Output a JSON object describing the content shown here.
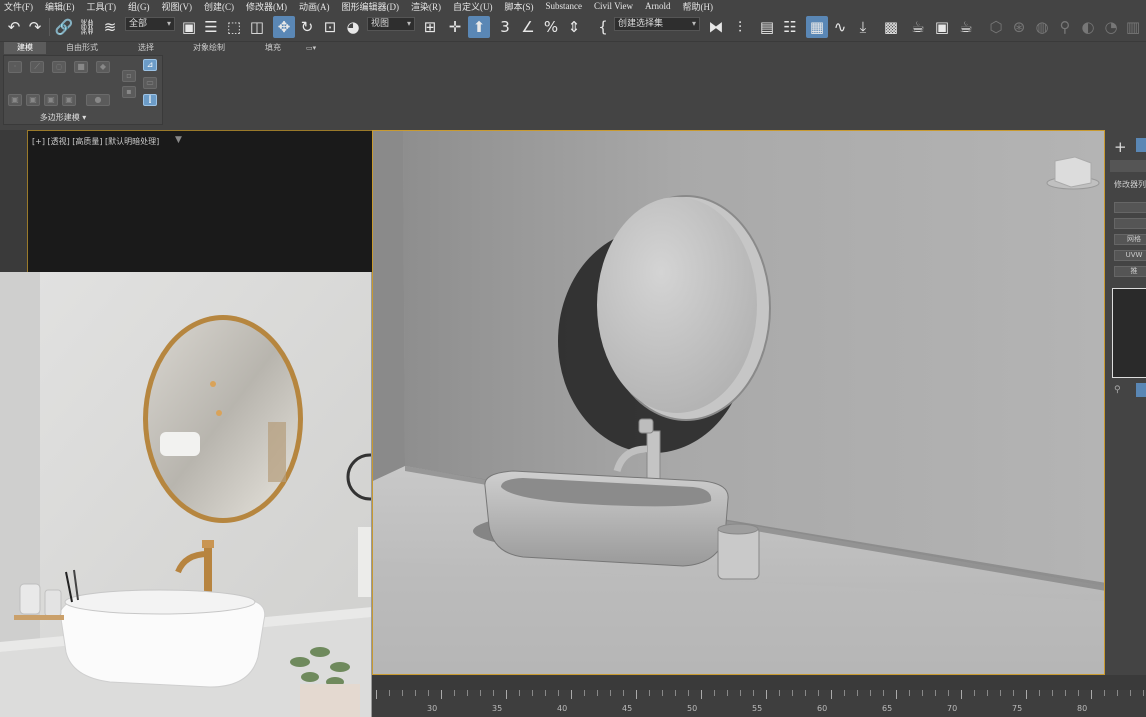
{
  "menu": [
    "文件(F)",
    "编辑(E)",
    "工具(T)",
    "组(G)",
    "视图(V)",
    "创建(C)",
    "修改器(M)",
    "动画(A)",
    "图形编辑器(D)",
    "渲染(R)",
    "自定义(U)",
    "脚本(S)",
    "Substance",
    "Civil View",
    "Arnold",
    "帮助(H)"
  ],
  "toolbar": {
    "filter_value": "全部",
    "refcoord_value": "视图",
    "selection_set_placeholder": "创建选择集"
  },
  "ribbon": {
    "tabs": [
      "建模",
      "自由形式",
      "选择",
      "对象绘制",
      "填充"
    ],
    "panel_label": "多边形建模"
  },
  "viewport_left": {
    "label": "[+] [透视] [高质量] [默认明暗处理]"
  },
  "command_panel": {
    "modifier_list_label": "修改器列",
    "buttons": [
      "",
      "",
      "网格",
      "UVW",
      "推"
    ]
  },
  "timeline": {
    "ticks": [
      30,
      35,
      40,
      45,
      50,
      55,
      60,
      65,
      70,
      75,
      80
    ]
  },
  "icons": [
    "undo-icon",
    "redo-icon",
    "link-icon",
    "unlink-icon",
    "bind-spacewarp-icon",
    "select-object-icon",
    "select-by-name-icon",
    "rect-selection-icon",
    "window-crossing-icon",
    "select-move-icon",
    "select-rotate-icon",
    "select-scale-icon",
    "pivot-icon",
    "snap-toggle-icon",
    "angle-snap-icon",
    "percent-snap-icon",
    "spinner-snap-icon",
    "mirror-icon",
    "align-icon",
    "scene-explorer-icon",
    "layer-explorer-icon",
    "ribbon-icon",
    "curve-editor-icon",
    "schematic-icon",
    "material-editor-icon",
    "render-setup-icon",
    "render-frame-icon",
    "render-icon",
    "plus-icon"
  ],
  "colors": {
    "accent": "#5a87b5",
    "viewport_border": "#c89a30"
  }
}
